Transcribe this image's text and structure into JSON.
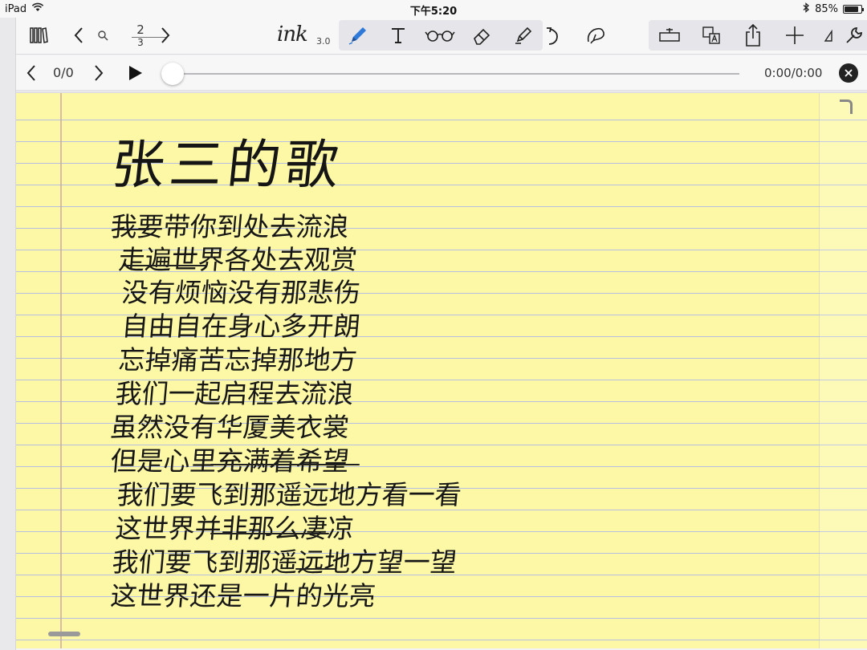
{
  "status_bar": {
    "device": "iPad",
    "time": "下午5:20",
    "battery_percent": "85%",
    "battery_level": 0.85
  },
  "toolbar": {
    "page_current": "2",
    "page_total": "3",
    "logo_text": "ink",
    "logo_version": "3.0",
    "icons": [
      "library-icon",
      "chevron-left-icon",
      "magnifier-icon",
      "chevron-right-icon",
      "pen-icon",
      "text-icon",
      "glasses-icon",
      "eraser-icon",
      "highlighter-icon",
      "undo-icon",
      "lasso-icon",
      "insert-box-icon",
      "translate-icon",
      "share-icon",
      "plus-icon",
      "ruler-icon",
      "wrench-icon"
    ]
  },
  "playback": {
    "count": "0/0",
    "time": "0:00/0:00",
    "progress": 0
  },
  "note": {
    "title": "张三的歌",
    "lines": [
      "我要带你到处去流浪",
      "走遍世界各处去观赏",
      "没有烦恼没有那悲伤",
      "自由自在身心多开朗",
      "忘掉痛苦忘掉那地方",
      "我们一起启程去流浪",
      "虽然没有华厦美衣裳",
      "但是心里充满着希望",
      "我们要飞到那遥远地方看一看",
      "这世界并非那么凄凉",
      "我们要飞到那遥远地方望一望",
      "这世界还是一片的光亮"
    ]
  },
  "colors": {
    "paper": "#fdf8a6",
    "rule_line": "#b7bfe0",
    "accent_pen": "#2f7ad8"
  }
}
